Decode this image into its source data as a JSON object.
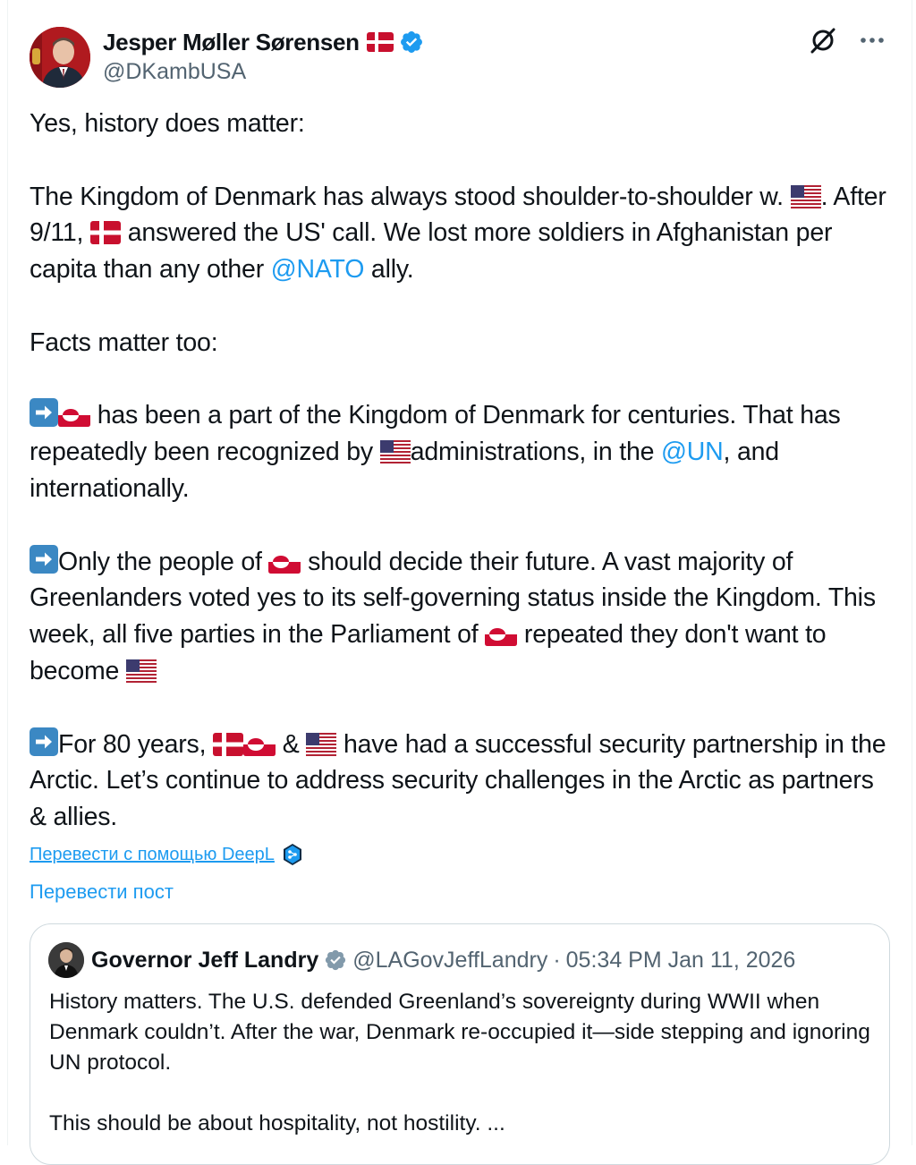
{
  "author": {
    "name": "Jesper Møller Sørensen",
    "handle": "@DKambUSA",
    "name_flag": "dk-flag-icon",
    "verified": true
  },
  "actions": {
    "grok_icon": "grok-icon",
    "more_icon": "more-options-icon"
  },
  "post": {
    "p1": "Yes, history does matter:",
    "p2_a": "The Kingdom of Denmark has always stood shoulder-to-shoulder w. ",
    "p2_b": ". After 9/11, ",
    "p2_c": " answered the US' call. We lost more soldiers in Afghanistan per capita than any other ",
    "p2_mention": "@NATO",
    "p2_d": " ally.",
    "p3": "Facts matter too:",
    "p4_a": " has been a part of the Kingdom of Denmark for centuries. That has repeatedly been recognized by ",
    "p4_b": "administrations, in the ",
    "p4_mention": "@UN",
    "p4_c": ", and internationally.",
    "p5_a": "Only the people of ",
    "p5_b": " should decide their future. A vast majority of Greenlanders voted yes to its self-governing status inside the Kingdom. This week, all five parties in the Parliament of ",
    "p5_c": " repeated they don't want to become ",
    "p6_a": "For 80 years, ",
    "p6_b": " & ",
    "p6_c": " have had a successful security partnership in the Arctic. Let’s continue to address security challenges in the Arctic as partners & allies."
  },
  "translate": {
    "deepl_label": "Перевести с помощью DeepL",
    "post_label": "Перевести пост"
  },
  "quote": {
    "name": "Governor Jeff Landry",
    "handle": "@LAGovJeffLandry",
    "separator": "·",
    "timestamp": "05:34 PM Jan 11, 2026",
    "text_1": "History matters. The U.S. defended Greenland’s sovereignty during WWII when Denmark couldn’t. After the war, Denmark re-occupied it—side stepping and ignoring UN protocol.",
    "text_2": "This should be about hospitality, not hostility. ..."
  },
  "colors": {
    "accent": "#1d9bf0",
    "secondary_text": "#536471",
    "border": "#cfd9de",
    "verified_blue": "#1d9bf0",
    "verified_gray": "#829aab"
  }
}
